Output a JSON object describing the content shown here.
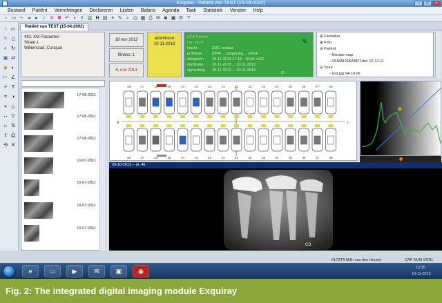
{
  "window": {
    "title": "Exquise - Patient van TEST (15-04-2002)"
  },
  "menu": [
    "Bestand",
    "Patiënt",
    "Verrichtingen",
    "Declareren",
    "Lijsten",
    "Balans",
    "Agenda",
    "Taak",
    "Statistiek",
    "Venster",
    "Help"
  ],
  "tab": {
    "label": "Patiënt van TEST (15-04-2002)"
  },
  "address": {
    "line1": "481: KM Pacianten",
    "line2": "Straat 1",
    "line3": "Willemstad, Curaçao"
  },
  "info_buttons": [
    {
      "label": "18 nov 2013",
      "color": "#222222"
    },
    {
      "label": "fitness: 1",
      "color": "#222222"
    },
    {
      "label": "8, nov 2013",
      "color": "#b0201c"
    }
  ],
  "anamnese": {
    "label": "anamnese",
    "date": "10-11-2013"
  },
  "green_panel": {
    "header": "ECK Patiënt van TEST",
    "rows": [
      {
        "label": "klacht",
        "value": "ERG nrekast"
      },
      {
        "label": "prothese",
        "value": "DPIR ... proposing ... ERVF"
      },
      {
        "label": "allergieën",
        "value": "10-11-2013 17:18 - 10:06 +/AC"
      },
      {
        "label": "medicatie",
        "value": "10-11-2013 ... 10-11-2013"
      },
      {
        "label": "opmerking",
        "value": "10-11-2013 ... 10-11-2013"
      }
    ],
    "footer": "ID"
  },
  "tree": {
    "items": [
      {
        "label": "Formulier",
        "level": 0
      },
      {
        "label": "Foto",
        "level": 0
      },
      {
        "label": "Patiënt",
        "level": 0
      },
      {
        "label": "Nieuwe map",
        "level": 1
      },
      {
        "label": "VERWIJSKAART.doc 12-12-11",
        "level": 1
      },
      {
        "label": "Scan",
        "level": 0
      },
      {
        "label": "test.jpg 04-10-06",
        "level": 1
      }
    ]
  },
  "image_list": [
    {
      "date": "17-08-2011"
    },
    {
      "date": "17-08-2011"
    },
    {
      "date": "17-08-2011"
    },
    {
      "date": "10-07-2011"
    },
    {
      "date": "15-07-2011"
    },
    {
      "date": "15-07-2011"
    },
    {
      "date": "15-07-2011"
    }
  ],
  "dental_chart": {
    "upper": [
      "18",
      "17",
      "16",
      "15",
      "14",
      "13",
      "12",
      "11",
      "21",
      "22",
      "23",
      "24",
      "25",
      "26",
      "27",
      "28"
    ],
    "lower": [
      "48",
      "47",
      "46",
      "45",
      "44",
      "43",
      "42",
      "41",
      "31",
      "32",
      "33",
      "34",
      "35",
      "36",
      "37",
      "38"
    ],
    "side_left": "R",
    "side_right": "L"
  },
  "xray": {
    "header": "29-10-2013 -- el. 46",
    "label": "CS"
  },
  "status": {
    "user": "KLTZTA M.B. van den Heuvel",
    "caps": "CAP NUM SCRL"
  },
  "taskbar": {
    "time": "12:35",
    "date": "10-11-2013"
  },
  "caption": {
    "text": "Fig. 2: The integrated digital imaging module Exquiray"
  },
  "colors": {
    "green": "#3aa641",
    "yellow": "#ece04a",
    "caption": "#8ba63a",
    "xray_bar": "#0e2f75"
  }
}
